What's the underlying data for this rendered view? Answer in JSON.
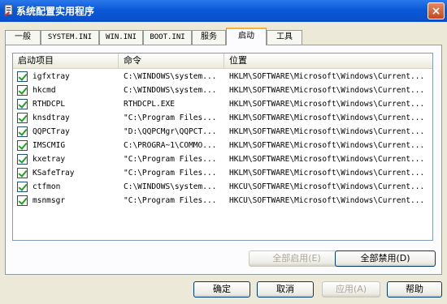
{
  "window": {
    "title": "系统配置实用程序",
    "close_glyph": "×"
  },
  "tabs": [
    {
      "label": "一般",
      "active": false
    },
    {
      "label": "SYSTEM.INI",
      "active": false
    },
    {
      "label": "WIN.INI",
      "active": false
    },
    {
      "label": "BOOT.INI",
      "active": false
    },
    {
      "label": "服务",
      "active": false
    },
    {
      "label": "启动",
      "active": true
    },
    {
      "label": "工具",
      "active": false
    }
  ],
  "table": {
    "columns": [
      "启动项目",
      "命令",
      "位置"
    ],
    "rows": [
      {
        "checked": true,
        "item": "igfxtray",
        "command": "C:\\WINDOWS\\system...",
        "location": "HKLM\\SOFTWARE\\Microsoft\\Windows\\Current..."
      },
      {
        "checked": true,
        "item": "hkcmd",
        "command": "C:\\WINDOWS\\system...",
        "location": "HKLM\\SOFTWARE\\Microsoft\\Windows\\Current..."
      },
      {
        "checked": true,
        "item": "RTHDCPL",
        "command": "RTHDCPL.EXE",
        "location": "HKLM\\SOFTWARE\\Microsoft\\Windows\\Current..."
      },
      {
        "checked": true,
        "item": "knsdtray",
        "command": "\"C:\\Program Files...",
        "location": "HKLM\\SOFTWARE\\Microsoft\\Windows\\Current..."
      },
      {
        "checked": true,
        "item": "QQPCTray",
        "command": "\"D:\\QQPCMgr\\QQPCT...",
        "location": "HKLM\\SOFTWARE\\Microsoft\\Windows\\Current..."
      },
      {
        "checked": true,
        "item": "IMSCMIG",
        "command": "C:\\PROGRA~1\\COMMO...",
        "location": "HKLM\\SOFTWARE\\Microsoft\\Windows\\Current..."
      },
      {
        "checked": true,
        "item": "kxetray",
        "command": "\"C:\\Program Files...",
        "location": "HKLM\\SOFTWARE\\Microsoft\\Windows\\Current..."
      },
      {
        "checked": true,
        "item": "KSafeTray",
        "command": "\"C:\\Program Files...",
        "location": "HKLM\\SOFTWARE\\Microsoft\\Windows\\Current..."
      },
      {
        "checked": true,
        "item": "ctfmon",
        "command": "C:\\WINDOWS\\system...",
        "location": "HKCU\\SOFTWARE\\Microsoft\\Windows\\Current..."
      },
      {
        "checked": true,
        "item": "msnmsgr",
        "command": "\"C:\\Program Files...",
        "location": "HKCU\\SOFTWARE\\Microsoft\\Windows\\Current..."
      }
    ]
  },
  "buttons": {
    "enable_all": "全部启用(E)",
    "disable_all": "全部禁用(D)",
    "ok": "确定",
    "cancel": "取消",
    "apply": "应用(A)",
    "help": "帮助"
  },
  "colors": {
    "titlebar": "#0a58d8",
    "active_tab_accent": "#f8b334",
    "check": "#21a121"
  }
}
